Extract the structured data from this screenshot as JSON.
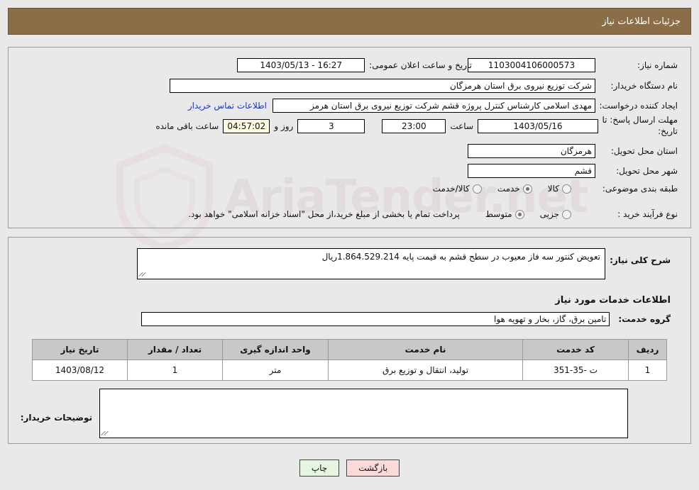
{
  "header": {
    "title": "جزئیات اطلاعات نیاز",
    "bar_color": "#8b6d47"
  },
  "watermark": {
    "text": "AriaTender.net"
  },
  "top_panel": {
    "need_number_label": "شماره نیاز:",
    "need_number_value": "1103004106000573",
    "announce_datetime_label": "تاریخ و ساعت اعلان عمومی:",
    "announce_datetime_value": "1403/05/13 - 16:27",
    "buyer_org_label": "نام دستگاه خریدار:",
    "buyer_org_value": "شرکت توزیع نیروی برق استان هرمزگان",
    "requester_label": "ایجاد کننده درخواست:",
    "requester_value": "مهدی اسلامی کارشناس کنترل پروژه قشم شرکت توزیع نیروی برق استان هرمز",
    "contact_link": "اطلاعات تماس خریدار",
    "deadline_label": "مهلت ارسال پاسخ: تا تاریخ:",
    "deadline_date": "1403/05/16",
    "deadline_hour_label": "ساعت",
    "deadline_hour_value": "23:00",
    "days_value": "3",
    "days_label": "روز و",
    "countdown_value": "04:57:02",
    "countdown_label": "ساعت باقی مانده",
    "province_label": "استان محل تحویل:",
    "province_value": "هرمزگان",
    "city_label": "شهر محل تحویل:",
    "city_value": "قشم",
    "category_label": "طبقه بندی موضوعی:",
    "category_options": [
      {
        "label": "کالا",
        "selected": false
      },
      {
        "label": "خدمت",
        "selected": true
      },
      {
        "label": "کالا/خدمت",
        "selected": false
      }
    ],
    "process_label": "نوع فرآیند خرید :",
    "process_options": [
      {
        "label": "جزیی",
        "selected": false
      },
      {
        "label": "متوسط",
        "selected": true
      }
    ],
    "process_note": "پرداخت تمام یا بخشی از مبلغ خرید،از محل \"اسناد خزانه اسلامی\" خواهد بود."
  },
  "mid_panel": {
    "general_desc_label": "شرح کلی نیاز:",
    "general_desc_value": "تعویض کنتور سه فاز معیوب در سطح قشم به قیمت پایه 1.864.529.214ریال",
    "services_heading": "اطلاعات خدمات مورد نیاز",
    "service_group_label": "گروه خدمت:",
    "service_group_value": "تامین برق، گاز، بخار و تهویه هوا",
    "buyer_notes_label": "توضیحات خریدار:",
    "buyer_notes_value": ""
  },
  "table": {
    "columns": [
      "ردیف",
      "کد خدمت",
      "نام خدمت",
      "واحد اندازه گیری",
      "تعداد / مقدار",
      "تاریخ نیاز"
    ],
    "rows": [
      {
        "index": "1",
        "code": "ت -35-351",
        "name": "تولید، انتقال و توزیع برق",
        "unit": "متر",
        "quantity": "1",
        "need_date": "1403/08/12"
      }
    ]
  },
  "buttons": {
    "print": "چاپ",
    "back": "بازگشت"
  }
}
